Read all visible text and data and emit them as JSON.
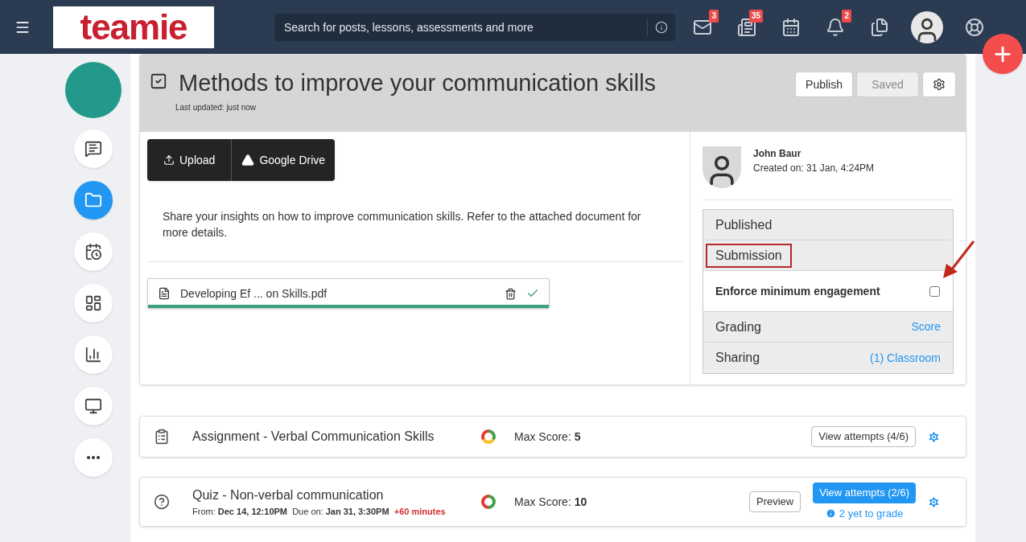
{
  "header": {
    "logo": "teamie",
    "search": {
      "placeholder": "Search for posts, lessons, assessments and more"
    },
    "icons": [
      {
        "kind": "mail",
        "badge": "3"
      },
      {
        "kind": "news",
        "badge": "35"
      },
      {
        "kind": "calendar"
      },
      {
        "kind": "bell",
        "badge": "2"
      },
      {
        "kind": "files"
      },
      {
        "kind": "avatar"
      },
      {
        "kind": "help"
      }
    ],
    "fab": "+"
  },
  "sidebar": {
    "items": [
      {
        "kind": "chat",
        "selected": false
      },
      {
        "kind": "folder",
        "selected": true
      },
      {
        "kind": "schedule",
        "selected": false
      },
      {
        "kind": "dashboard",
        "selected": false
      },
      {
        "kind": "chart",
        "selected": false
      },
      {
        "kind": "monitor",
        "selected": false
      },
      {
        "kind": "more",
        "selected": false
      }
    ]
  },
  "lesson": {
    "title": "Methods to improve your communication skills",
    "updated": "Last updated: just now",
    "publish": "Publish",
    "saved": "Saved",
    "upload": "Upload",
    "drive": "Google Drive",
    "description": "Share your insights on how to improve communication skills. Refer to the attached document for more details.",
    "file": {
      "name": "Developing Ef ... on Skills.pdf",
      "level": 1
    },
    "author": {
      "name": "John Baur",
      "created": "Created on: 31 Jan, 4:24PM"
    },
    "settings": [
      {
        "kind": "header",
        "label": "Published",
        "highlighted": false
      },
      {
        "kind": "header",
        "label": "Submission",
        "highlighted": true
      },
      {
        "kind": "checkbox",
        "label": "Enforce minimum engagement",
        "checked": false
      },
      {
        "kind": "link",
        "label": "Grading",
        "value": "Score"
      },
      {
        "kind": "link",
        "label": "Sharing",
        "value": "(1) Classroom"
      }
    ]
  },
  "items": [
    {
      "kind": "assignment",
      "title": "Assignment - Verbal Communication Skills",
      "ring": [
        {
          "color": "#43a047"
        },
        {
          "color": "#fbc02d"
        },
        {
          "color": "#e53935"
        }
      ],
      "max_label": "Max Score:",
      "max": "5",
      "attempts": "View attempts (4/6)",
      "attempts_primary": false
    },
    {
      "kind": "quiz",
      "title": "Quiz - Non-verbal communication",
      "from_label": "From:",
      "from": "Dec 14, 12:10PM",
      "due_label": "Due on:",
      "due": "Jan 31, 3:30PM",
      "extra": "+60 minutes",
      "ring": [
        {
          "color": "#43a047"
        },
        {
          "color": "#e53935"
        }
      ],
      "max_label": "Max Score:",
      "max": "10",
      "preview": "Preview",
      "attempts": "View attempts (2/6)",
      "attempts_primary": true,
      "to_grade": "2 yet to grade"
    }
  ]
}
